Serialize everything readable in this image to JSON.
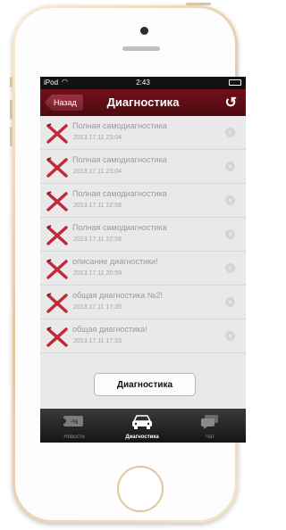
{
  "status_bar": {
    "carrier": "iPod",
    "time": "2:43"
  },
  "nav": {
    "back_label": "Назад",
    "title": "Диагностика",
    "refresh_icon": "refresh-icon"
  },
  "items": [
    {
      "title": "Полная самодиагностика",
      "date": "2013.17.11 23:04"
    },
    {
      "title": "Полная самодиагностика",
      "date": "2013.17.11 23:04"
    },
    {
      "title": "Полная самодиагностика",
      "date": "2013.17.11 22:58"
    },
    {
      "title": "Полная самодиагностика",
      "date": "2013.17.11 22:58"
    },
    {
      "title": "описание диагностики!",
      "date": "2013.17.11 20:59"
    },
    {
      "title": "общая диагностика №2!",
      "date": "2013.17.11 17:35"
    },
    {
      "title": "общая диагностика!",
      "date": "2013.17.11 17:33"
    }
  ],
  "diagnostics_button": "Диагностика",
  "tabs": [
    {
      "label": "Новости",
      "icon": "discount-tag-icon",
      "badge": "-%"
    },
    {
      "label": "Диагностика",
      "icon": "car-icon"
    },
    {
      "label": "Чат",
      "icon": "chat-bubbles-icon"
    }
  ],
  "colors": {
    "nav_bar": "#5e0d15",
    "list_background": "#e9e9e9",
    "error_icon": "#c0283a",
    "phone_gold": "#e2c99e"
  }
}
